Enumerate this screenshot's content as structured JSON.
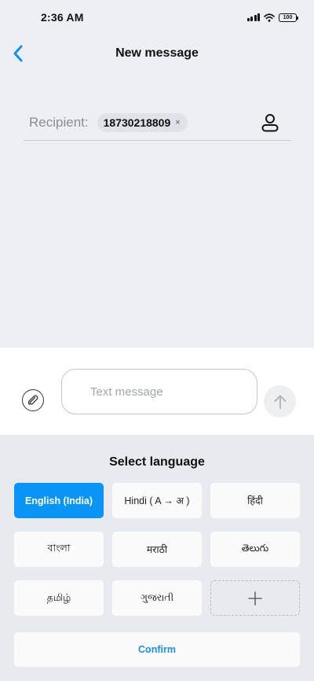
{
  "status_bar": {
    "time": "2:36 AM",
    "battery": "100"
  },
  "header": {
    "title": "New message"
  },
  "recipient": {
    "label": "Recipient:",
    "chip_number": "18730218809",
    "chip_remove": "×"
  },
  "compose": {
    "placeholder": "Text message"
  },
  "language_panel": {
    "title": "Select language",
    "options": [
      {
        "label": "English (India)",
        "selected": true
      },
      {
        "label": "Hindi ( A → अ )",
        "selected": false
      },
      {
        "label": "हिंदी",
        "selected": false
      },
      {
        "label": "বাংলা",
        "selected": false
      },
      {
        "label": "मराठी",
        "selected": false
      },
      {
        "label": "తెలుగు",
        "selected": false
      },
      {
        "label": "தமிழ்",
        "selected": false
      },
      {
        "label": "ગુજરાતી",
        "selected": false
      }
    ],
    "add_label": "+",
    "confirm_label": "Confirm"
  },
  "colors": {
    "accent": "#0a94f6",
    "confirm_text": "#1a8fe6",
    "panel_bg": "#e7eaef",
    "page_bg": "#eceff4"
  }
}
